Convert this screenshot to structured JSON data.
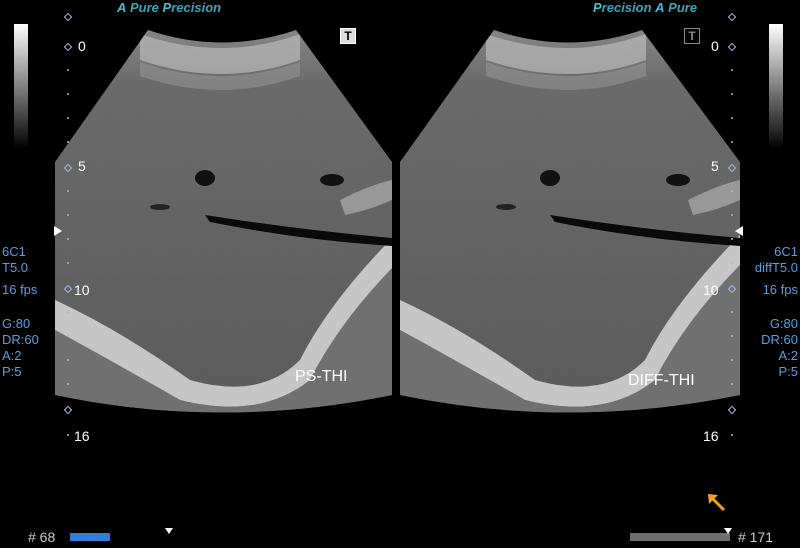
{
  "brand": {
    "left": {
      "a": "A",
      "pure": "Pure",
      "p": "P",
      "precision": "recision"
    },
    "right": {
      "p": "P",
      "precision": "recision",
      "a": "A",
      "pure": "Pure"
    }
  },
  "depth_scale": {
    "left": [
      "0",
      "5",
      "10",
      "16"
    ],
    "right": [
      "0",
      "5",
      "10",
      "16"
    ]
  },
  "left_params": [
    "6C1",
    "T5.0",
    "16 fps",
    "",
    "G:80",
    "DR:60",
    "A:2",
    "P:5"
  ],
  "right_params": [
    "6C1",
    "diffT5.0",
    "16 fps",
    "",
    "G:80",
    "DR:60",
    "A:2",
    "P:5"
  ],
  "images": {
    "left": {
      "mode": "PS-THI",
      "marker_icon": "T"
    },
    "right": {
      "mode": "DIFF-THI",
      "marker_icon": "T"
    }
  },
  "cine": {
    "left": {
      "frame_label": "# 68",
      "progress": 0.4
    },
    "right": {
      "frame_label": "# 171",
      "progress": 1.0
    }
  },
  "colors": {
    "param_text": "#5aa0e0",
    "brand": "#3aa6b9",
    "cine_bar_left": "#2f7fd9",
    "cine_bar_right": "#6e6e6e",
    "pointer": "#f0a020"
  },
  "icons": {
    "pointer": "arrow-up-left-icon"
  }
}
